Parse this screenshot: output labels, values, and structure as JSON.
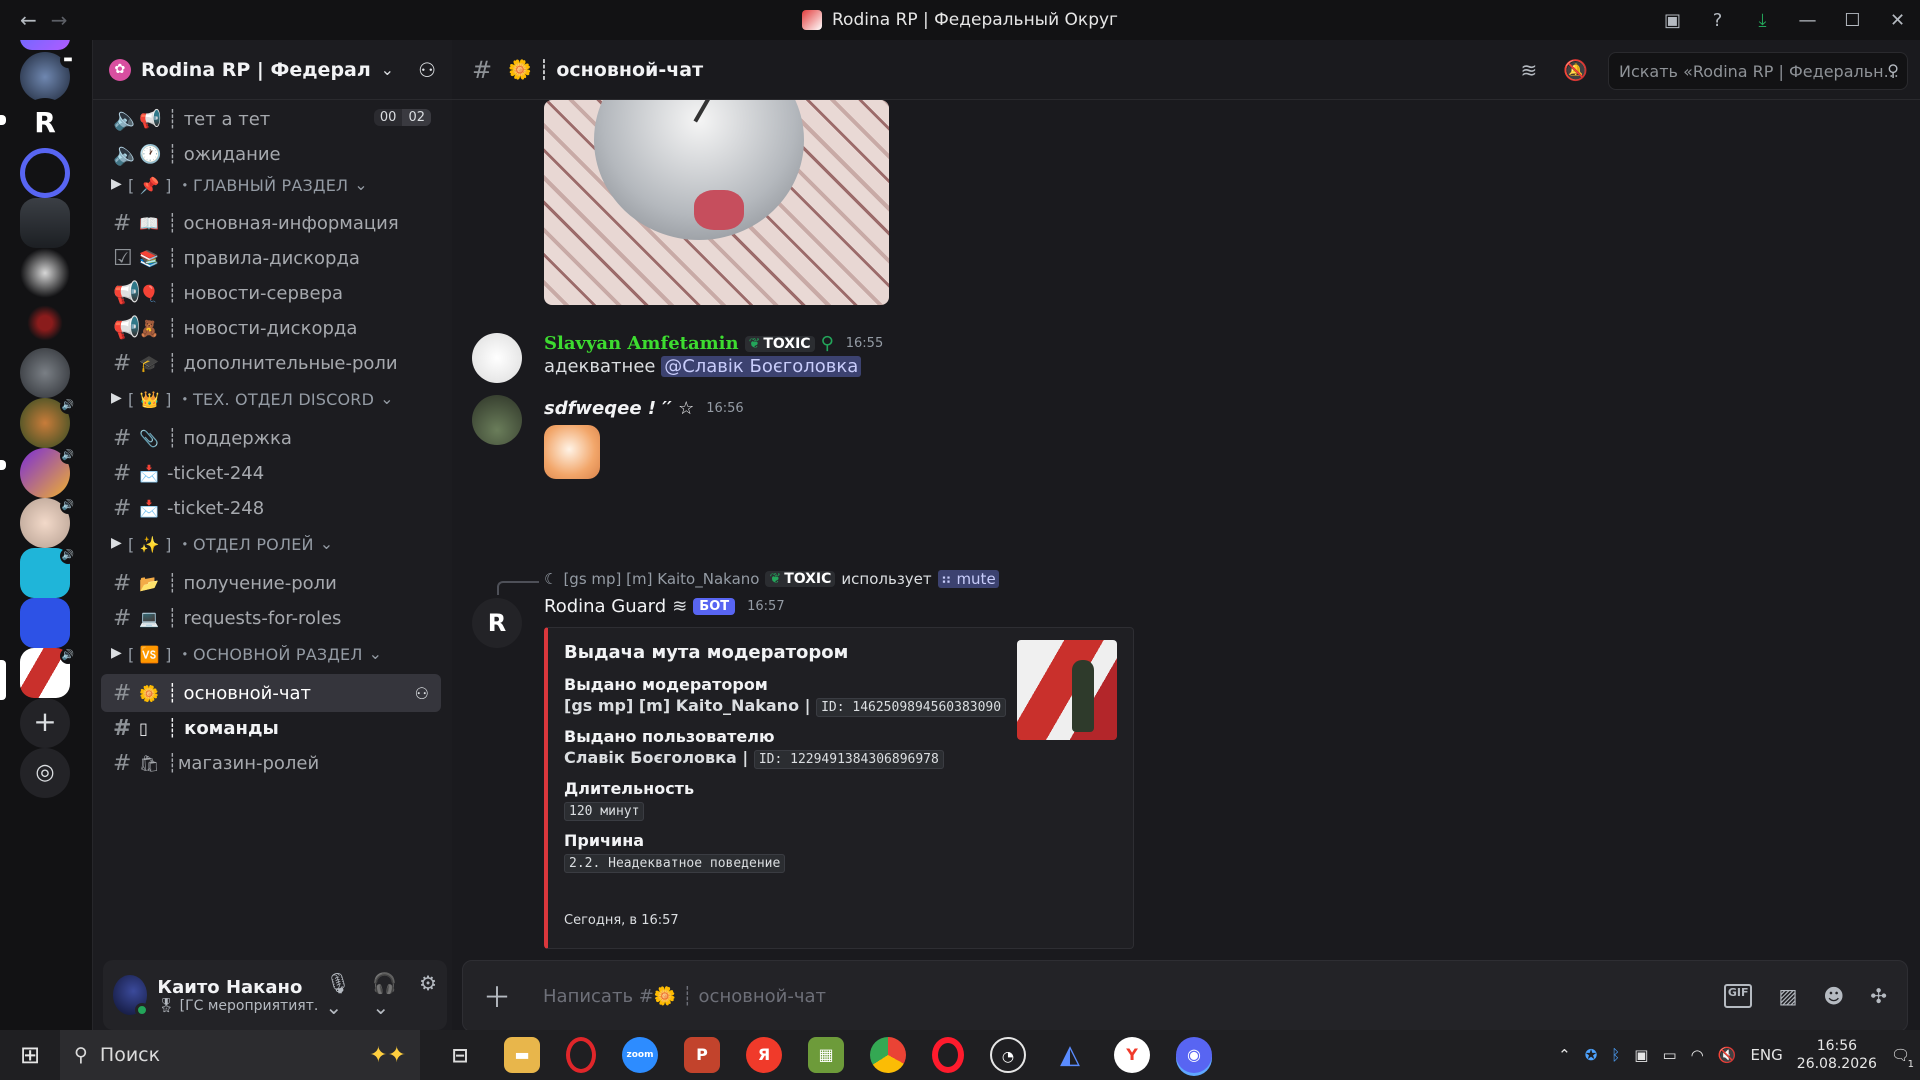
{
  "window": {
    "title": "Rodina RP | Федеральный Округ"
  },
  "server": {
    "name": "Rodina RP | Федеральн...",
    "search_placeholder": "Искать «Rodina RP | Федеральн..."
  },
  "channels": {
    "voice": [
      {
        "label": "📢 ┊ тет а тет",
        "count_a": "00",
        "count_b": "02"
      },
      {
        "label": "🕐 ┊ ожидание"
      }
    ],
    "categories": [
      {
        "label": "[ 📌 ] ・ГЛАВНЫЙ РАЗДЕЛ"
      },
      {
        "label": "[ 👑 ] ・ТЕХ. ОТДЕЛ DISCORD"
      },
      {
        "label": "[ ✨ ] ・ОТДЕЛ РОЛЕЙ"
      },
      {
        "label": "[ 🆚 ] ・ОСНОВНОЙ РАЗДЕЛ"
      }
    ],
    "items": [
      {
        "emoji": "📖",
        "label": "┊ основная-информация"
      },
      {
        "emoji": "📚",
        "label": "┊ правила-дискорда"
      },
      {
        "emoji": "🎈",
        "label": "┊ новости-сервера"
      },
      {
        "emoji": "🧸",
        "label": "┊ новости-дискорда"
      },
      {
        "emoji": "🎓",
        "label": "┊ дополнительные-роли"
      },
      {
        "emoji": "📎",
        "label": "┊ поддержка"
      },
      {
        "emoji": "📩",
        "label": "-ticket-244"
      },
      {
        "emoji": "📩",
        "label": "-ticket-248"
      },
      {
        "emoji": "📂",
        "label": "┊ получение-роли"
      },
      {
        "emoji": "💻",
        "label": "┊ requests-for-roles"
      },
      {
        "emoji": "🌼",
        "label": "┊ основной-чат"
      },
      {
        "emoji": "▯",
        "label": "┊ команды"
      },
      {
        "emoji": "🛍",
        "label": "┊магазин-ролей"
      }
    ]
  },
  "user": {
    "name": "Каито Накано",
    "status": "🎖 [ГС мероприятият..."
  },
  "header": {
    "channel": "🌼 ┊ основной-чат"
  },
  "messages": [
    {
      "author": "Slavyan Amfetamin",
      "tag": "TOXIC",
      "time": "16:55",
      "text": "адекватнее",
      "mention": "@Славік Боєголовка"
    },
    {
      "author": "sdfweqee ! ′′ ☆",
      "time": "16:56"
    }
  ],
  "reply": {
    "author": "[gs mp] [m] Kaito_Nakano",
    "tag": "TOXIC",
    "verb": "использует",
    "command": "mute"
  },
  "bot_message": {
    "author": "Rodina Guard",
    "badge": "БОТ",
    "time": "16:57",
    "embed": {
      "title": "Выдача мута модератором",
      "f1_name": "Выдано модератором",
      "f1_value": "[gs mp] [m] Kaito_Nakano |",
      "f1_code": "ID: 1462509894560383090",
      "f2_name": "Выдано пользователю",
      "f2_value": "Славік Боєголовка |",
      "f2_code": "ID: 1229491384306896978",
      "f3_name": "Длительность",
      "f3_code": "120 минут",
      "f4_name": "Причина",
      "f4_code": "2.2. Неадекватное поведение",
      "footer": "Сегодня, в 16:57"
    }
  },
  "composer": {
    "placeholder": "Написать #🌼 ┊ основной-чат",
    "gif": "GIF"
  },
  "taskbar": {
    "search": "Поиск",
    "lang": "ENG",
    "time": "16:56",
    "date": "26.08.2026",
    "notifications": "1"
  },
  "colors": {
    "accent": "#5865f2",
    "embed_bar": "#da373c",
    "online": "#23a55a",
    "slavyan_name": "#3ddc30"
  }
}
